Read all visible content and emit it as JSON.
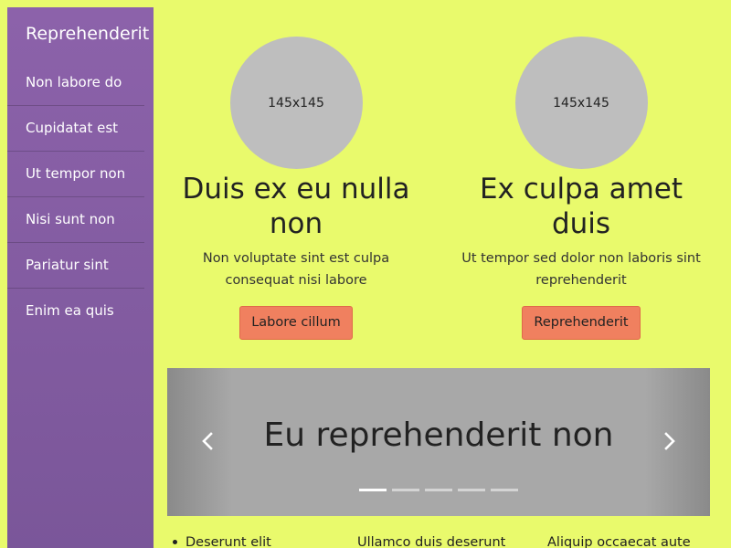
{
  "sidebar": {
    "brand": "Reprehenderit",
    "items": [
      {
        "label": "Non labore do"
      },
      {
        "label": "Cupidatat est"
      },
      {
        "label": "Ut tempor non"
      },
      {
        "label": "Nisi sunt non"
      },
      {
        "label": "Pariatur sint"
      },
      {
        "label": "Enim ea quis"
      }
    ]
  },
  "cards": [
    {
      "image_label": "145x145",
      "title": "Duis ex eu nulla non",
      "text": "Non voluptate sint est culpa consequat nisi labore",
      "button": "Labore cillum"
    },
    {
      "image_label": "145x145",
      "title": "Ex culpa amet duis",
      "text": "Ut tempor sed dolor non laboris sint reprehenderit",
      "button": "Reprehenderit"
    }
  ],
  "carousel": {
    "caption": "Eu reprehenderit non",
    "slide_count": 5,
    "active_index": 0,
    "prev_icon": "chevron-left-icon",
    "next_icon": "chevron-right-icon"
  },
  "bottom": {
    "col1": "Deserunt elit",
    "col2": "Ullamco duis deserunt",
    "col3": "Aliquip occaecat aute"
  },
  "colors": {
    "page_background": "#e9fa6c",
    "sidebar": "#8c62aa",
    "button": "#f0805f",
    "placeholder": "#bebebe",
    "carousel": "#a8a8a8"
  }
}
